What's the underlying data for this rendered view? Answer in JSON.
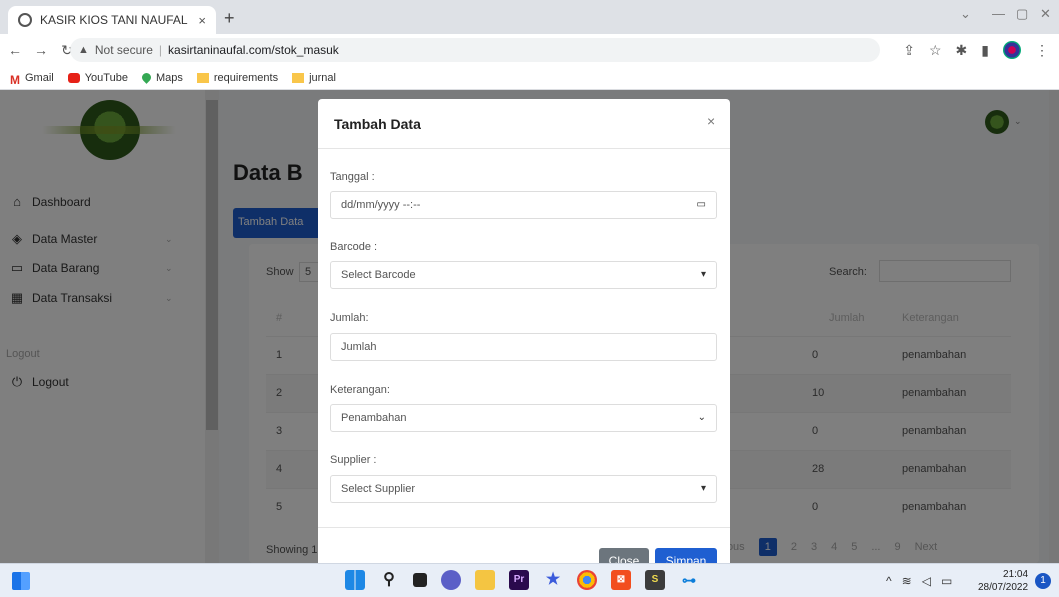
{
  "browser": {
    "tab_title": "KASIR KIOS TANI NAUFAL",
    "tab_close": "×",
    "new_tab": "+",
    "security_label": "Not secure",
    "url": "kasirtaninaufal.com/stok_masuk",
    "bookmarks": [
      "Gmail",
      "YouTube",
      "Maps",
      "requirements",
      "jurnal"
    ]
  },
  "sidebar": {
    "items": [
      {
        "label": "Dashboard",
        "icon": "home-icon"
      },
      {
        "label": "Data Master",
        "icon": "cube-icon"
      },
      {
        "label": "Data Barang",
        "icon": "box-icon"
      },
      {
        "label": "Data Transaksi",
        "icon": "grid-icon"
      }
    ],
    "logout_heading": "Logout",
    "logout_label": "Logout"
  },
  "main": {
    "page_title": "Data B",
    "add_button": "Tambah Data",
    "show_label": "Show",
    "show_value": "5",
    "search_label": "Search:",
    "columns": [
      "#",
      "Jumlah",
      "Keterangan"
    ],
    "rows": [
      {
        "no": "1",
        "jumlah": "0",
        "keterangan": "penambahan"
      },
      {
        "no": "2",
        "jumlah": "10",
        "keterangan": "penambahan"
      },
      {
        "no": "3",
        "jumlah": "0",
        "keterangan": "penambahan"
      },
      {
        "no": "4",
        "jumlah": "28",
        "keterangan": "penambahan"
      },
      {
        "no": "5",
        "jumlah": "0",
        "keterangan": "penambahan"
      }
    ],
    "showing_text": "Showing 1",
    "pagination": [
      "vious",
      "1",
      "2",
      "3",
      "4",
      "5",
      "...",
      "9",
      "Next"
    ]
  },
  "modal": {
    "title": "Tambah Data",
    "close_x": "×",
    "tanggal_label": "Tanggal :",
    "tanggal_placeholder": "dd/mm/yyyy --:--",
    "barcode_label": "Barcode :",
    "barcode_value": "Select Barcode",
    "jumlah_label": "Jumlah:",
    "jumlah_placeholder": "Jumlah",
    "keterangan_label": "Keterangan:",
    "keterangan_value": "Penambahan",
    "supplier_label": "Supplier :",
    "supplier_value": "Select Supplier",
    "close_button": "Close",
    "save_button": "Simpan"
  },
  "taskbar": {
    "time": "21:04",
    "date": "28/07/2022",
    "notifications": "1"
  }
}
